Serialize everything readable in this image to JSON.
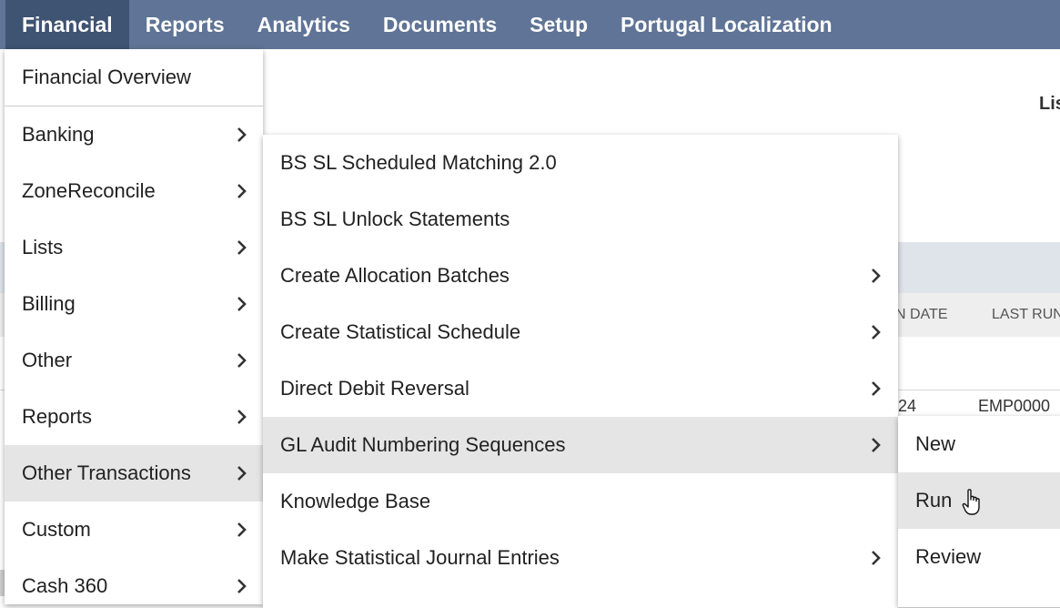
{
  "nav": {
    "items": [
      {
        "label": "Financial",
        "active": true
      },
      {
        "label": "Reports",
        "active": false
      },
      {
        "label": "Analytics",
        "active": false
      },
      {
        "label": "Documents",
        "active": false
      },
      {
        "label": "Setup",
        "active": false
      },
      {
        "label": "Portugal Localization",
        "active": false
      }
    ]
  },
  "background": {
    "list_label": "Lis",
    "col_headers": [
      "N DATE",
      "LAST RUN"
    ],
    "cells": [
      "24",
      "EMP0000"
    ]
  },
  "financial_menu": {
    "overview": "Financial Overview",
    "items": [
      {
        "label": "Banking",
        "has_submenu": true
      },
      {
        "label": "ZoneReconcile",
        "has_submenu": true
      },
      {
        "label": "Lists",
        "has_submenu": true
      },
      {
        "label": "Billing",
        "has_submenu": true
      },
      {
        "label": "Other",
        "has_submenu": true
      },
      {
        "label": "Reports",
        "has_submenu": true
      },
      {
        "label": "Other Transactions",
        "has_submenu": true,
        "highlighted": true
      },
      {
        "label": "Custom",
        "has_submenu": true
      },
      {
        "label": "Cash 360",
        "has_submenu": true
      }
    ]
  },
  "other_transactions_menu": {
    "items": [
      {
        "label": "BS SL Scheduled Matching 2.0",
        "has_submenu": false
      },
      {
        "label": "BS SL Unlock Statements",
        "has_submenu": false
      },
      {
        "label": "Create Allocation Batches",
        "has_submenu": true
      },
      {
        "label": "Create Statistical Schedule",
        "has_submenu": true
      },
      {
        "label": "Direct Debit Reversal",
        "has_submenu": true
      },
      {
        "label": "GL Audit Numbering Sequences",
        "has_submenu": true,
        "highlighted": true
      },
      {
        "label": "Knowledge Base",
        "has_submenu": false
      },
      {
        "label": "Make Statistical Journal Entries",
        "has_submenu": true
      }
    ]
  },
  "gl_audit_menu": {
    "items": [
      {
        "label": "New",
        "highlighted": false
      },
      {
        "label": "Run",
        "highlighted": true
      },
      {
        "label": "Review",
        "highlighted": false
      }
    ]
  },
  "icons": {
    "submenu_arrow": "chevron-right-icon",
    "pointer": "hand-pointer-icon"
  },
  "colors": {
    "navbar": "#5f7496",
    "navbar_active": "#3f5372",
    "menu_highlight": "#e5e5e5"
  }
}
